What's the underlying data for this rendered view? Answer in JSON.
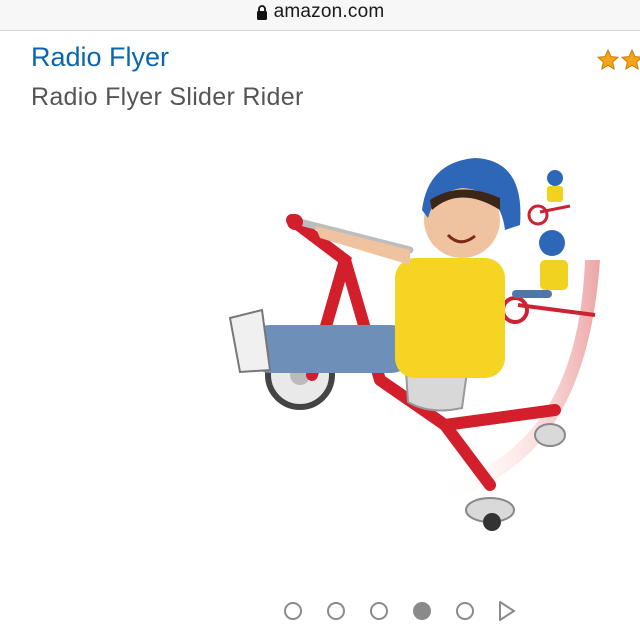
{
  "browser": {
    "url": "amazon.com",
    "lock_icon": "lock-icon"
  },
  "product": {
    "brand": "Radio Flyer",
    "title": "Radio Flyer Slider Rider",
    "rating_icon": "star-icon",
    "image_alt": "",
    "colors": {
      "brand_link": "#0a66b0",
      "star": "#f3a41b",
      "trike_red": "#d21f2b"
    }
  },
  "carousel": {
    "total_slides": 5,
    "active_index": 3,
    "next_icon": "play-next-icon"
  }
}
